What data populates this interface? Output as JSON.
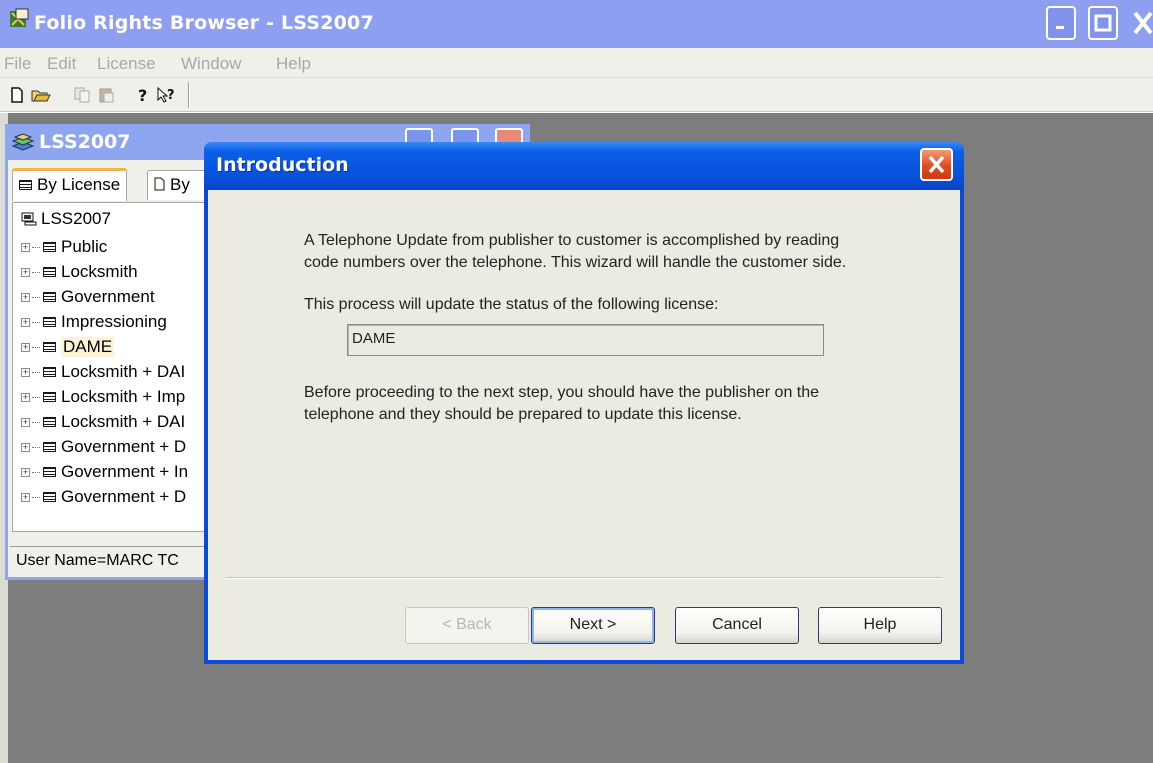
{
  "app": {
    "title": "Folio Rights Browser - LSS2007"
  },
  "menu": [
    "File",
    "Edit",
    "License",
    "Window",
    "Help"
  ],
  "toolbar": {
    "buttons": [
      "new-document-icon",
      "open-folder-icon",
      "copy-icon",
      "paste-icon",
      "help-icon",
      "context-help-icon"
    ]
  },
  "child_window": {
    "title": "LSS2007",
    "tabs": [
      "By License",
      "By"
    ],
    "tree_root": "LSS2007",
    "tree_items": [
      "Public",
      "Locksmith",
      "Government",
      "Impressioning",
      "DAME",
      "Locksmith + DAI",
      "Locksmith + Imp",
      "Locksmith + DAI",
      "Government + D",
      "Government + In",
      "Government + D"
    ],
    "selected_item": "DAME",
    "status": "User Name=MARC TC"
  },
  "dialog": {
    "title": "Introduction",
    "paragraph1": "A Telephone Update from publisher to customer is accomplished by reading code numbers over the telephone. This wizard will handle the customer side.",
    "paragraph2": "This process will update the status of the following license:",
    "license_value": "DAME",
    "paragraph3": "Before proceeding to the next step, you should have the publisher on the telephone and they should be prepared to update this license.",
    "buttons": {
      "back": "< Back",
      "next": "Next >",
      "cancel": "Cancel",
      "help": "Help"
    }
  },
  "colors": {
    "titlebar_inactive": "#8e9ef0",
    "dialog_titlebar": "#0a52dc",
    "workspace": "#7d7d7d",
    "dialog_body": "#ecebe2"
  }
}
